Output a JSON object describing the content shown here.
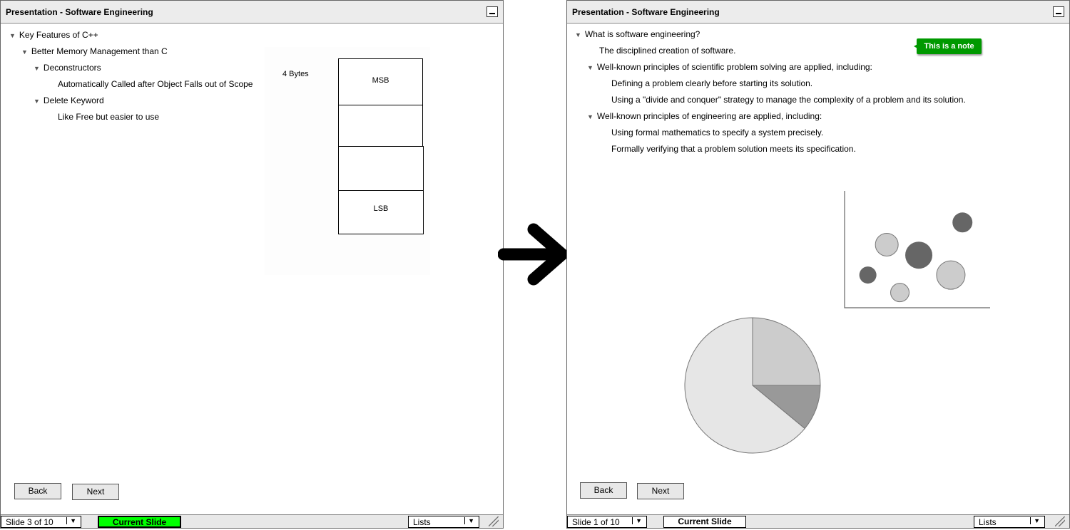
{
  "left": {
    "title": "Presentation - Software Engineering",
    "outline": [
      {
        "text": "Key Features of C++",
        "level": 0,
        "expanded": true
      },
      {
        "text": "Better Memory Management than C",
        "level": 1,
        "expanded": true
      },
      {
        "text": "Deconstructors",
        "level": 2,
        "expanded": true
      },
      {
        "text": "Automatically Called after Object Falls out of Scope",
        "level": 3
      },
      {
        "text": "Delete Keyword",
        "level": 2,
        "expanded": true
      },
      {
        "text": "Like Free but easier to use",
        "level": 3
      }
    ],
    "diagram": {
      "size_label": "4 Bytes",
      "cells": [
        "MSB",
        "",
        "",
        "LSB"
      ]
    },
    "back": "Back",
    "next": "Next",
    "slide": "Slide 3 of 10",
    "current": "Current Slide",
    "current_color": "#00ff00",
    "view": "Lists"
  },
  "right": {
    "title": "Presentation - Software Engineering",
    "outline": [
      {
        "text": "What is software engineering?",
        "level": 0,
        "expanded": true
      },
      {
        "text": "The disciplined creation of software.",
        "level": 1
      },
      {
        "text": "Well-known principles of scientific problem solving are applied, including:",
        "level": 1,
        "expanded": true
      },
      {
        "text": "Defining a problem clearly before starting its solution.",
        "level": 2
      },
      {
        "text": "Using a \"divide and conquer\" strategy to manage the complexity of a problem and its solution.",
        "level": 2
      },
      {
        "text": "Well-known principles of engineering are applied, including:",
        "level": 1,
        "expanded": true
      },
      {
        "text": "Using formal mathematics to specify a system precisely.",
        "level": 2
      },
      {
        "text": "Formally verifying that a problem solution meets its specification.",
        "level": 2
      }
    ],
    "note": "This is a note",
    "note_color": "#009900",
    "back": "Back",
    "next": "Next",
    "slide": "Slide 1 of 10",
    "current": "Current Slide",
    "view": "Lists"
  },
  "arrow_icon": "arrow-right-icon",
  "chart_data": [
    {
      "type": "scatter",
      "bubbles": [
        {
          "x": 16,
          "y": 28,
          "size": 12,
          "color": "#666666"
        },
        {
          "x": 29,
          "y": 54,
          "size": 16,
          "color": "#cccccc"
        },
        {
          "x": 38,
          "y": 13,
          "size": 13,
          "color": "#cccccc"
        },
        {
          "x": 51,
          "y": 45,
          "size": 19,
          "color": "#666666"
        },
        {
          "x": 73,
          "y": 28,
          "size": 20,
          "color": "#cccccc"
        },
        {
          "x": 81,
          "y": 73,
          "size": 14,
          "color": "#666666"
        }
      ],
      "xlim": [
        0,
        100
      ],
      "ylim": [
        0,
        100
      ]
    },
    {
      "type": "pie",
      "values": [
        25,
        11,
        64
      ],
      "colors": [
        "#cccccc",
        "#999999",
        "#e6e6e6"
      ]
    }
  ]
}
